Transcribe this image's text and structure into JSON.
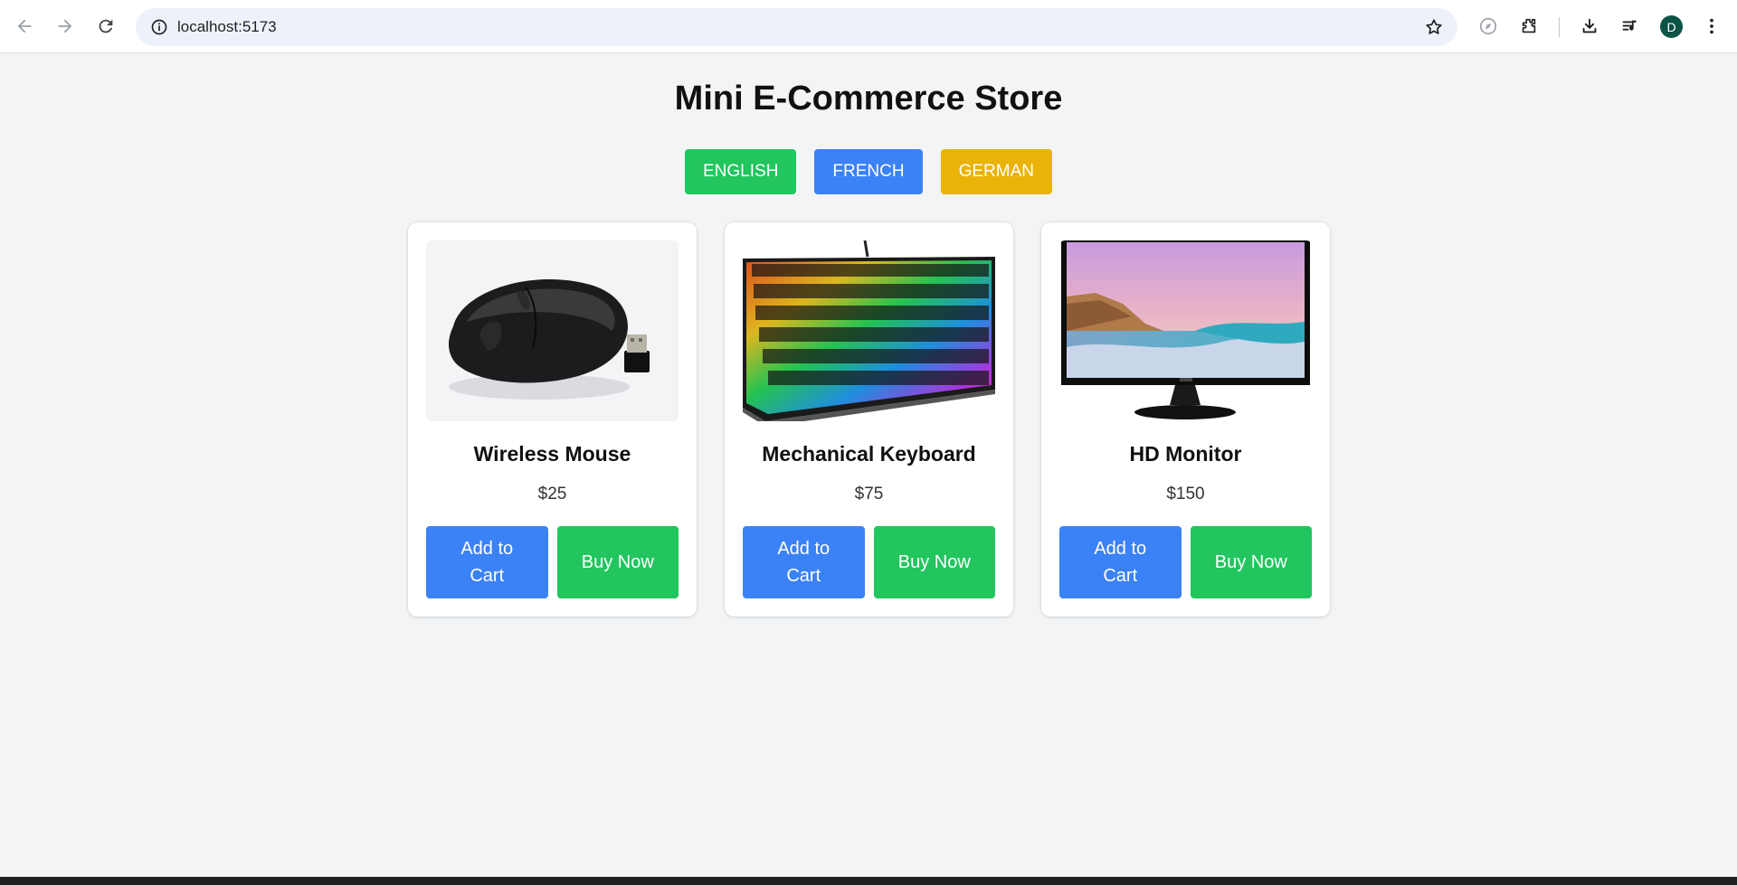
{
  "browser": {
    "url": "localhost:5173",
    "avatar_letter": "D",
    "colors": {
      "toolbar": "#ffffff",
      "omnibox": "#edf2fa",
      "avatar": "#0b5345"
    }
  },
  "store": {
    "title": "Mini E-Commerce Store",
    "languages": [
      {
        "label": "ENGLISH",
        "color": "#22c55e"
      },
      {
        "label": "FRENCH",
        "color": "#3b82f6"
      },
      {
        "label": "GERMAN",
        "color": "#eab308"
      }
    ],
    "products": [
      {
        "name": "Wireless Mouse",
        "price": "$25",
        "image": "mouse-image",
        "add_label": "Add to Cart",
        "buy_label": "Buy Now"
      },
      {
        "name": "Mechanical Keyboard",
        "price": "$75",
        "image": "keyboard-image",
        "add_label": "Add to Cart",
        "buy_label": "Buy Now"
      },
      {
        "name": "HD Monitor",
        "price": "$150",
        "image": "monitor-image",
        "add_label": "Add to Cart",
        "buy_label": "Buy Now"
      }
    ],
    "colors": {
      "add_button": "#3b82f6",
      "buy_button": "#22c55e",
      "page_bg": "#f3f4f6"
    }
  }
}
